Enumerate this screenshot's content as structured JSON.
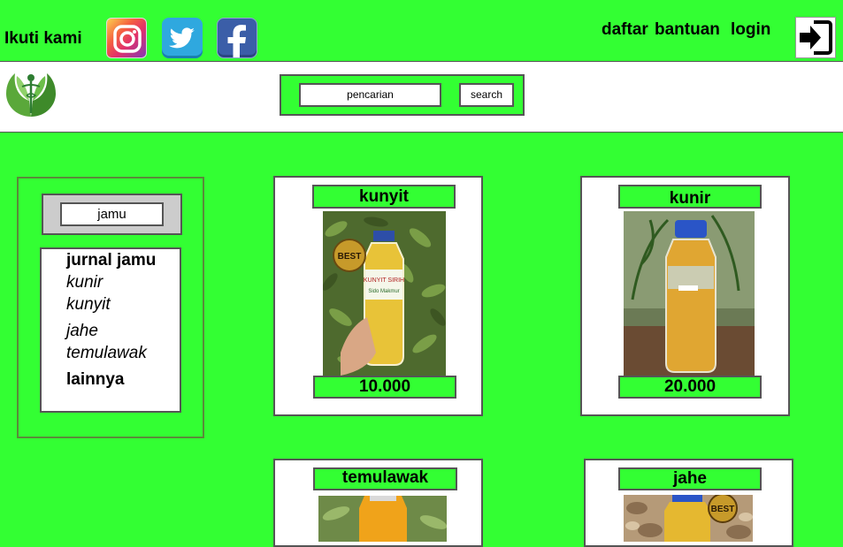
{
  "topbar": {
    "follow_label": "Ikuti kami",
    "social": [
      "instagram-icon",
      "twitter-icon",
      "facebook-icon"
    ],
    "nav": {
      "daftar": "daftar",
      "bantuan": "bantuan",
      "login": "login"
    }
  },
  "search": {
    "value": "pencarian",
    "button": "search"
  },
  "sidebar": {
    "category_value": "jamu",
    "items": [
      {
        "label": "jurnal jamu"
      },
      {
        "label": "kunir"
      },
      {
        "label": "kunyit"
      },
      {
        "label": "jahe"
      },
      {
        "label": "temulawak"
      },
      {
        "label": "lainnya"
      }
    ]
  },
  "products": [
    {
      "name": "kunyit",
      "price": "10.000"
    },
    {
      "name": "kunir",
      "price": "20.000"
    },
    {
      "name": "temulawak"
    },
    {
      "name": "jahe"
    }
  ],
  "colors": {
    "accent": "#33ff33",
    "border": "#555555"
  }
}
